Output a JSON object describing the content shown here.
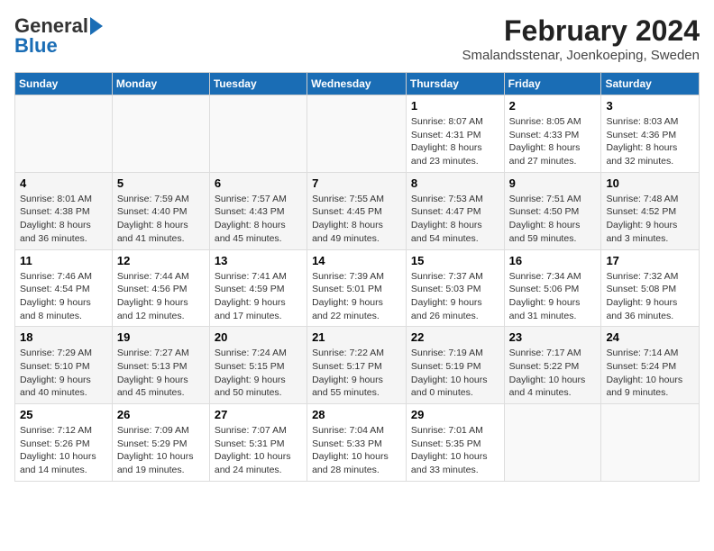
{
  "header": {
    "logo_line1": "General",
    "logo_line2": "Blue",
    "title": "February 2024",
    "subtitle": "Smalandsstenar, Joenkoeping, Sweden"
  },
  "weekdays": [
    "Sunday",
    "Monday",
    "Tuesday",
    "Wednesday",
    "Thursday",
    "Friday",
    "Saturday"
  ],
  "weeks": [
    [
      {
        "day": "",
        "info": ""
      },
      {
        "day": "",
        "info": ""
      },
      {
        "day": "",
        "info": ""
      },
      {
        "day": "",
        "info": ""
      },
      {
        "day": "1",
        "info": "Sunrise: 8:07 AM\nSunset: 4:31 PM\nDaylight: 8 hours\nand 23 minutes."
      },
      {
        "day": "2",
        "info": "Sunrise: 8:05 AM\nSunset: 4:33 PM\nDaylight: 8 hours\nand 27 minutes."
      },
      {
        "day": "3",
        "info": "Sunrise: 8:03 AM\nSunset: 4:36 PM\nDaylight: 8 hours\nand 32 minutes."
      }
    ],
    [
      {
        "day": "4",
        "info": "Sunrise: 8:01 AM\nSunset: 4:38 PM\nDaylight: 8 hours\nand 36 minutes."
      },
      {
        "day": "5",
        "info": "Sunrise: 7:59 AM\nSunset: 4:40 PM\nDaylight: 8 hours\nand 41 minutes."
      },
      {
        "day": "6",
        "info": "Sunrise: 7:57 AM\nSunset: 4:43 PM\nDaylight: 8 hours\nand 45 minutes."
      },
      {
        "day": "7",
        "info": "Sunrise: 7:55 AM\nSunset: 4:45 PM\nDaylight: 8 hours\nand 49 minutes."
      },
      {
        "day": "8",
        "info": "Sunrise: 7:53 AM\nSunset: 4:47 PM\nDaylight: 8 hours\nand 54 minutes."
      },
      {
        "day": "9",
        "info": "Sunrise: 7:51 AM\nSunset: 4:50 PM\nDaylight: 8 hours\nand 59 minutes."
      },
      {
        "day": "10",
        "info": "Sunrise: 7:48 AM\nSunset: 4:52 PM\nDaylight: 9 hours\nand 3 minutes."
      }
    ],
    [
      {
        "day": "11",
        "info": "Sunrise: 7:46 AM\nSunset: 4:54 PM\nDaylight: 9 hours\nand 8 minutes."
      },
      {
        "day": "12",
        "info": "Sunrise: 7:44 AM\nSunset: 4:56 PM\nDaylight: 9 hours\nand 12 minutes."
      },
      {
        "day": "13",
        "info": "Sunrise: 7:41 AM\nSunset: 4:59 PM\nDaylight: 9 hours\nand 17 minutes."
      },
      {
        "day": "14",
        "info": "Sunrise: 7:39 AM\nSunset: 5:01 PM\nDaylight: 9 hours\nand 22 minutes."
      },
      {
        "day": "15",
        "info": "Sunrise: 7:37 AM\nSunset: 5:03 PM\nDaylight: 9 hours\nand 26 minutes."
      },
      {
        "day": "16",
        "info": "Sunrise: 7:34 AM\nSunset: 5:06 PM\nDaylight: 9 hours\nand 31 minutes."
      },
      {
        "day": "17",
        "info": "Sunrise: 7:32 AM\nSunset: 5:08 PM\nDaylight: 9 hours\nand 36 minutes."
      }
    ],
    [
      {
        "day": "18",
        "info": "Sunrise: 7:29 AM\nSunset: 5:10 PM\nDaylight: 9 hours\nand 40 minutes."
      },
      {
        "day": "19",
        "info": "Sunrise: 7:27 AM\nSunset: 5:13 PM\nDaylight: 9 hours\nand 45 minutes."
      },
      {
        "day": "20",
        "info": "Sunrise: 7:24 AM\nSunset: 5:15 PM\nDaylight: 9 hours\nand 50 minutes."
      },
      {
        "day": "21",
        "info": "Sunrise: 7:22 AM\nSunset: 5:17 PM\nDaylight: 9 hours\nand 55 minutes."
      },
      {
        "day": "22",
        "info": "Sunrise: 7:19 AM\nSunset: 5:19 PM\nDaylight: 10 hours\nand 0 minutes."
      },
      {
        "day": "23",
        "info": "Sunrise: 7:17 AM\nSunset: 5:22 PM\nDaylight: 10 hours\nand 4 minutes."
      },
      {
        "day": "24",
        "info": "Sunrise: 7:14 AM\nSunset: 5:24 PM\nDaylight: 10 hours\nand 9 minutes."
      }
    ],
    [
      {
        "day": "25",
        "info": "Sunrise: 7:12 AM\nSunset: 5:26 PM\nDaylight: 10 hours\nand 14 minutes."
      },
      {
        "day": "26",
        "info": "Sunrise: 7:09 AM\nSunset: 5:29 PM\nDaylight: 10 hours\nand 19 minutes."
      },
      {
        "day": "27",
        "info": "Sunrise: 7:07 AM\nSunset: 5:31 PM\nDaylight: 10 hours\nand 24 minutes."
      },
      {
        "day": "28",
        "info": "Sunrise: 7:04 AM\nSunset: 5:33 PM\nDaylight: 10 hours\nand 28 minutes."
      },
      {
        "day": "29",
        "info": "Sunrise: 7:01 AM\nSunset: 5:35 PM\nDaylight: 10 hours\nand 33 minutes."
      },
      {
        "day": "",
        "info": ""
      },
      {
        "day": "",
        "info": ""
      }
    ]
  ]
}
